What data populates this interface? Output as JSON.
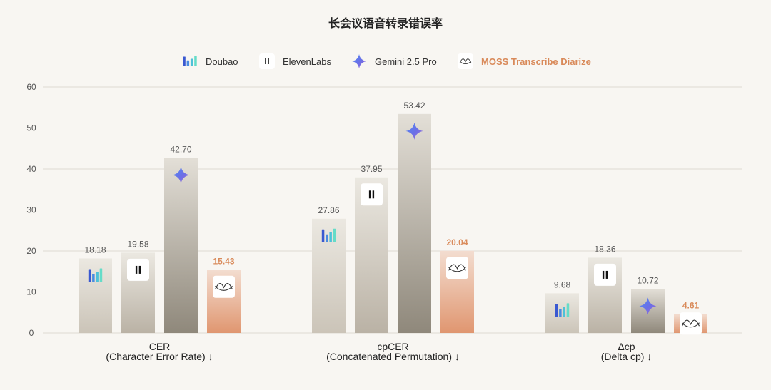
{
  "chart_data": {
    "type": "bar",
    "title": "长会议语音转录错误率",
    "ylim": [
      0,
      60
    ],
    "yticks": [
      0,
      10,
      20,
      30,
      40,
      50,
      60
    ],
    "grid": true,
    "legend_position": "top-center",
    "categories": [
      {
        "line1": "CER",
        "line2": "(Character Error Rate) ↓"
      },
      {
        "line1": "cpCER",
        "line2": "(Concatenated Permutation) ↓"
      },
      {
        "line1": "Δcp",
        "line2": "(Delta cp) ↓"
      }
    ],
    "series": [
      {
        "name": "Doubao",
        "icon": "doubao-icon",
        "values": [
          18.18,
          27.86,
          9.68
        ],
        "labels": [
          "18.18",
          "27.86",
          "9.68"
        ]
      },
      {
        "name": "ElevenLabs",
        "icon": "elevenlabs-icon",
        "values": [
          19.58,
          37.95,
          18.36
        ],
        "labels": [
          "19.58",
          "37.95",
          "18.36"
        ]
      },
      {
        "name": "Gemini 2.5 Pro",
        "icon": "gemini-icon",
        "values": [
          42.7,
          53.42,
          10.72
        ],
        "labels": [
          "42.70",
          "53.42",
          "10.72"
        ]
      },
      {
        "name": "MOSS Transcribe Diarize",
        "icon": "moss-icon",
        "values": [
          15.43,
          20.04,
          4.61
        ],
        "labels": [
          "15.43",
          "20.04",
          "4.61"
        ],
        "highlight": true
      }
    ],
    "colors": {
      "bar_top": "#ebe8e1",
      "bar_bottom_light": "#c8c0b3",
      "bar_bottom_dark": "#8f887b",
      "highlight_top": "#f3ddd0",
      "highlight_bottom": "#e09670",
      "highlight_text": "#d98a5a",
      "grid": "#dedad3",
      "background": "#f8f6f2"
    }
  }
}
